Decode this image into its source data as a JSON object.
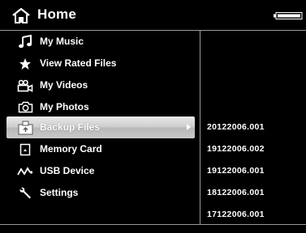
{
  "header": {
    "title": "Home"
  },
  "menu": {
    "items": [
      {
        "label": "My Music",
        "icon": "music-note-icon"
      },
      {
        "label": "View Rated Files",
        "icon": "star-icon"
      },
      {
        "label": "My Videos",
        "icon": "video-camera-icon"
      },
      {
        "label": "My Photos",
        "icon": "photo-camera-icon"
      },
      {
        "label": "Backup Files",
        "icon": "backup-folder-icon",
        "selected": true
      },
      {
        "label": "Memory Card",
        "icon": "memory-card-icon"
      },
      {
        "label": "USB Device",
        "icon": "usb-icon"
      },
      {
        "label": "Settings",
        "icon": "wrench-icon"
      }
    ]
  },
  "files": {
    "items": [
      "20122006.001",
      "19122006.002",
      "19122006.001",
      "18122006.001",
      "17122006.001"
    ]
  },
  "colors": {
    "background": "#000000",
    "text": "#ffffff",
    "selection": "#c8c8c8",
    "rule": "#9a9a9a"
  }
}
